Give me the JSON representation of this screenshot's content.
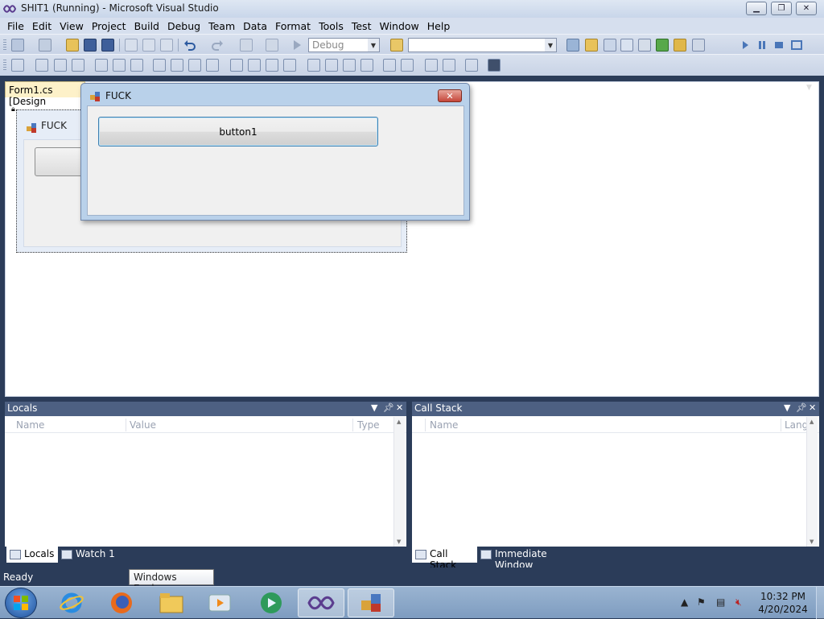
{
  "window": {
    "title": "SHIT1 (Running) - Microsoft Visual Studio"
  },
  "menu": [
    "File",
    "Edit",
    "View",
    "Project",
    "Build",
    "Debug",
    "Team",
    "Data",
    "Format",
    "Tools",
    "Test",
    "Window",
    "Help"
  ],
  "toolbar": {
    "config_value": "Debug",
    "platform_value": ""
  },
  "document": {
    "tab_label": "Form1.cs [Design"
  },
  "designer_form": {
    "caption": "FUCK"
  },
  "running_form": {
    "caption": "FUCK",
    "button_label": "button1"
  },
  "locals_panel": {
    "title": "Locals",
    "columns": [
      "Name",
      "Value",
      "Type"
    ],
    "tabs": [
      "Locals",
      "Watch 1"
    ]
  },
  "callstack_panel": {
    "title": "Call Stack",
    "columns": [
      "Name",
      "Lang"
    ],
    "tabs": [
      "Call Stack",
      "Immediate Window"
    ]
  },
  "status": {
    "text": "Ready"
  },
  "tooltip": {
    "text": "Windows Explorer"
  },
  "taskbar": {
    "time": "10:32 PM",
    "date": "4/20/2024"
  }
}
